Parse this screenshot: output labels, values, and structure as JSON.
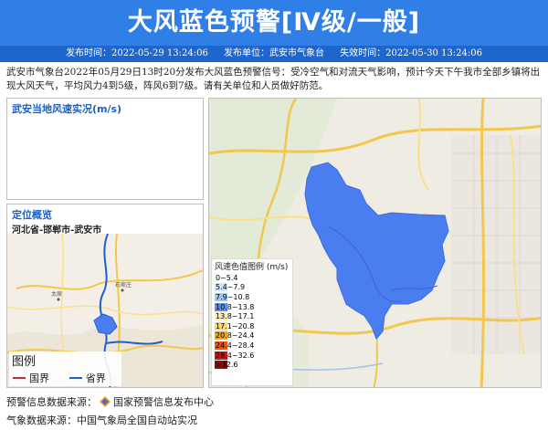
{
  "header": {
    "title": "大风蓝色预警[Ⅳ级/一般]",
    "publish_time": "发布时间：2022-05-29 13:24:06",
    "publisher": "发布单位：武安市气象台",
    "expire_time": "失效时间：2022-05-30 13:24:06"
  },
  "description": "武安市气象台2022年05月29日13时20分发布大风蓝色预警信号：受冷空气和对流天气影响，预计今天下午我市全部乡镇将出现大风天气，平均风力4到5级，阵风6到7级。请有关单位和人员做好防范。",
  "observation_panel": {
    "title": "武安当地风速实况(m/s)"
  },
  "location_panel": {
    "title": "定位概览",
    "path": "河北省-邯郸市-武安市",
    "map_labels": {
      "capital": "石家庄",
      "city_left": "太原"
    }
  },
  "map_legend": {
    "title": "图例",
    "national_border": "国界",
    "provincial_border": "省界",
    "national_color": "#b5303b",
    "provincial_color": "#1d5fd1"
  },
  "wind_legend": {
    "title": "风速色值图例 (m/s)",
    "items": [
      {
        "label": "0~5.4",
        "color": "#ffffff"
      },
      {
        "label": "5.4~7.9",
        "color": "#cfe3fb"
      },
      {
        "label": "7.9~10.8",
        "color": "#9fc9f5"
      },
      {
        "label": "10.8~13.8",
        "color": "#5f8fe6"
      },
      {
        "label": "13.8~17.1",
        "color": "#ffefb5"
      },
      {
        "label": "17.1~20.8",
        "color": "#fcd77a"
      },
      {
        "label": "20.8~24.4",
        "color": "#f5a223"
      },
      {
        "label": "24.4~28.4",
        "color": "#e8551f"
      },
      {
        "label": "28.4~32.6",
        "color": "#c21a1a"
      },
      {
        "label": ">32.6",
        "color": "#8b0d0d"
      }
    ]
  },
  "footer": {
    "warning_source": "预警信息数据来源：",
    "warning_source_name": "国家预警信息发布中心",
    "weather_source": "气象数据来源：中国气象局全国自动站实况"
  },
  "colors": {
    "banner": "#2f7fe6",
    "meta_bar": "#1f66cc",
    "region_fill": "#4a7ef0",
    "panel_title": "#1a5fc7"
  }
}
